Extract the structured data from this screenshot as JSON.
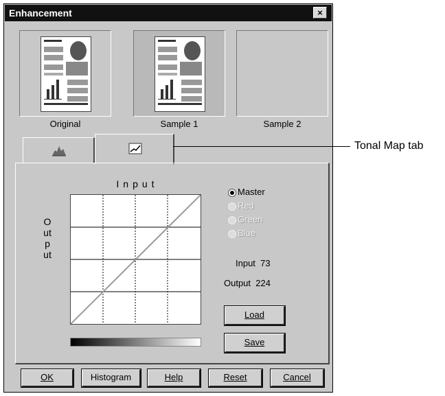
{
  "window": {
    "title": "Enhancement",
    "close_glyph": "×"
  },
  "previews": [
    {
      "label": "Original"
    },
    {
      "label": "Sample 1"
    },
    {
      "label": "Sample 2"
    }
  ],
  "tabs": [
    {
      "icon": "histogram-icon",
      "name": "Histogram tab"
    },
    {
      "icon": "tonal-curve-icon",
      "name": "Tonal Map tab"
    }
  ],
  "tonal_map": {
    "input_axis_label": "Input",
    "output_axis_label": "Output",
    "channels": [
      {
        "label": "Master",
        "selected": true,
        "enabled": true
      },
      {
        "label": "Red",
        "selected": false,
        "enabled": false
      },
      {
        "label": "Green",
        "selected": false,
        "enabled": false
      },
      {
        "label": "Blue",
        "selected": false,
        "enabled": false
      }
    ],
    "input_label": "Input",
    "input_value": "73",
    "output_label": "Output",
    "output_value": "224",
    "load_label": "Load",
    "save_label": "Save"
  },
  "footer_buttons": {
    "ok": "OK",
    "histogram": "Histogram",
    "help": "Help",
    "reset": "Reset",
    "cancel": "Cancel"
  },
  "annotation": {
    "text": "Tonal Map tab"
  }
}
